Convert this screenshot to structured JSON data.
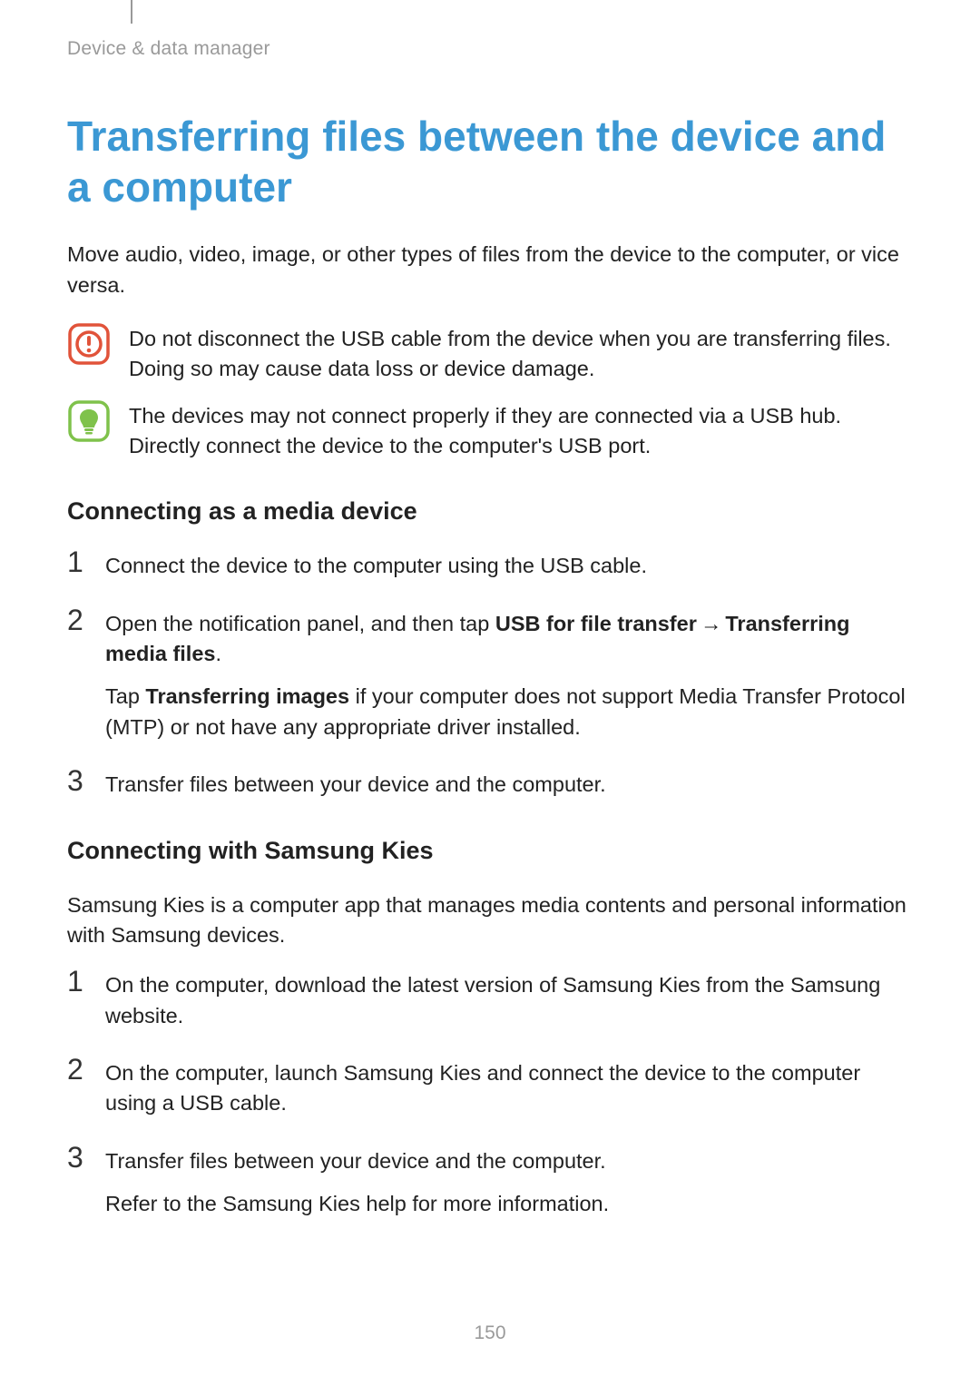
{
  "breadcrumb": "Device & data manager",
  "title": "Transferring files between the device and a computer",
  "intro": "Move audio, video, image, or other types of files from the device to the computer, or vice versa.",
  "callouts": [
    {
      "icon": "caution-icon",
      "text": "Do not disconnect the USB cable from the device when you are transferring files. Doing so may cause data loss or device damage."
    },
    {
      "icon": "note-icon",
      "text": "The devices may not connect properly if they are connected via a USB hub. Directly connect the device to the computer's USB port."
    }
  ],
  "section1": {
    "heading": "Connecting as a media device",
    "steps": [
      {
        "num": "1",
        "text": "Connect the device to the computer using the USB cable."
      },
      {
        "num": "2",
        "prefix": "Open the notification panel, and then tap ",
        "bold1": "USB for file transfer",
        "arrow": "→",
        "bold2": "Transferring media files",
        "suffix": ".",
        "extra_prefix": "Tap ",
        "extra_bold": "Transferring images",
        "extra_suffix": " if your computer does not support Media Transfer Protocol (MTP) or not have any appropriate driver installed."
      },
      {
        "num": "3",
        "text": "Transfer files between your device and the computer."
      }
    ]
  },
  "section2": {
    "heading": "Connecting with Samsung Kies",
    "intro": "Samsung Kies is a computer app that manages media contents and personal information with Samsung devices.",
    "steps": [
      {
        "num": "1",
        "text": "On the computer, download the latest version of Samsung Kies from the Samsung website."
      },
      {
        "num": "2",
        "text": "On the computer, launch Samsung Kies and connect the device to the computer using a USB cable."
      },
      {
        "num": "3",
        "text": "Transfer files between your device and the computer.",
        "extra": "Refer to the Samsung Kies help for more information."
      }
    ]
  },
  "page_number": "150",
  "colors": {
    "accent": "#3b98d4",
    "caution": "#e1533a",
    "note": "#7fc24b"
  }
}
